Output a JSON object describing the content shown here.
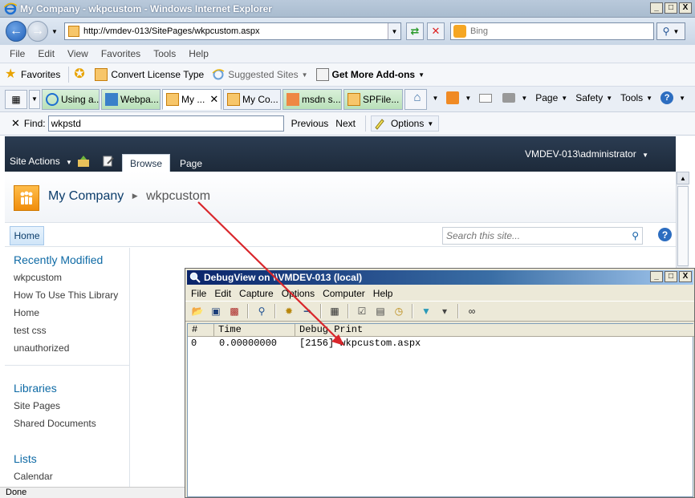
{
  "ie": {
    "title": "My Company - wkpcustom - Windows Internet Explorer",
    "window_buttons": [
      "_",
      "□",
      "X"
    ],
    "address_url": "http://vmdev-013/SitePages/wkpcustom.aspx",
    "search_placeholder": "Bing",
    "menu": [
      "File",
      "Edit",
      "View",
      "Favorites",
      "Tools",
      "Help"
    ],
    "favorites": {
      "favorites_label": "Favorites",
      "convert_label": "Convert License Type",
      "suggested_label": "Suggested Sites",
      "addons_label": "Get More Add-ons"
    },
    "tabs": [
      "Using a...",
      "Webpa...",
      "My ...",
      "My Co...",
      "msdn s...",
      "SPFile..."
    ],
    "command_bar": [
      "Page",
      "Safety",
      "Tools"
    ],
    "find": {
      "label": "Find:",
      "value": "wkpstd",
      "previous": "Previous",
      "next": "Next",
      "options": "Options"
    },
    "status": "Done"
  },
  "sharepoint": {
    "site_actions": "Site Actions",
    "tab_browse": "Browse",
    "tab_page": "Page",
    "user": "VMDEV-013\\administrator",
    "site_title": "My Company",
    "page_title": "wkpcustom",
    "nav_home": "Home",
    "search_placeholder": "Search this site...",
    "quicklaunch": {
      "recently_modified": "Recently Modified",
      "recent_items": [
        "wkpcustom",
        "How To Use This Library",
        "Home",
        "test css",
        "unauthorized"
      ],
      "libraries": "Libraries",
      "library_items": [
        "Site Pages",
        "Shared Documents"
      ],
      "lists": "Lists",
      "list_items": [
        "Calendar"
      ]
    }
  },
  "debugview": {
    "title": "DebugView on \\\\VMDEV-013 (local)",
    "menu": [
      "File",
      "Edit",
      "Capture",
      "Options",
      "Computer",
      "Help"
    ],
    "columns": [
      "#",
      "Time",
      "Debug Print"
    ],
    "rows": [
      {
        "num": "0",
        "time": "0.00000000",
        "text": "[2156] wkpcustom.aspx"
      }
    ]
  },
  "colors": {
    "ribbon_bg": "#1d2a3a",
    "annotation_arrow": "#d9262b",
    "sp_link": "#0e6aa5"
  }
}
